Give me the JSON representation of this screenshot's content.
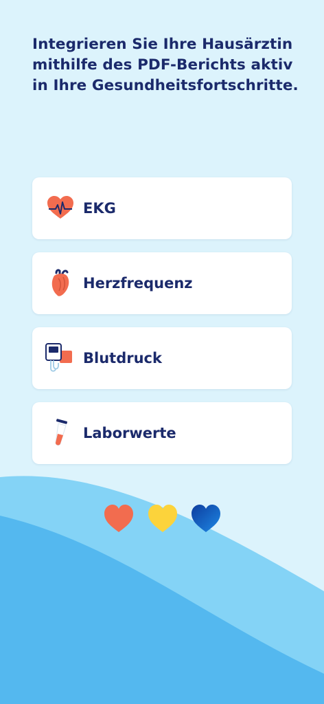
{
  "headline": "Integrieren Sie Ihre Hausärztin mithilfe des PDF-Berichts aktiv in Ihre Gesundheitsfortschritte.",
  "cards": [
    {
      "label": "EKG",
      "icon": "ecg-heart-icon"
    },
    {
      "label": "Herzfrequenz",
      "icon": "anatomical-heart-icon"
    },
    {
      "label": "Blutdruck",
      "icon": "blood-pressure-monitor-icon"
    },
    {
      "label": "Laborwerte",
      "icon": "test-tube-icon"
    }
  ],
  "hearts": [
    {
      "icon": "heart-icon",
      "color": "#f26c4f"
    },
    {
      "icon": "heart-icon",
      "color": "#fcd33b"
    },
    {
      "icon": "heart-icon",
      "color": "#1565c0"
    }
  ],
  "colors": {
    "background": "#dcf3fc",
    "wave_light": "#84d3f6",
    "wave_dark": "#54b8ef",
    "text": "#1b2a6b",
    "accent": "#f26c4f"
  }
}
